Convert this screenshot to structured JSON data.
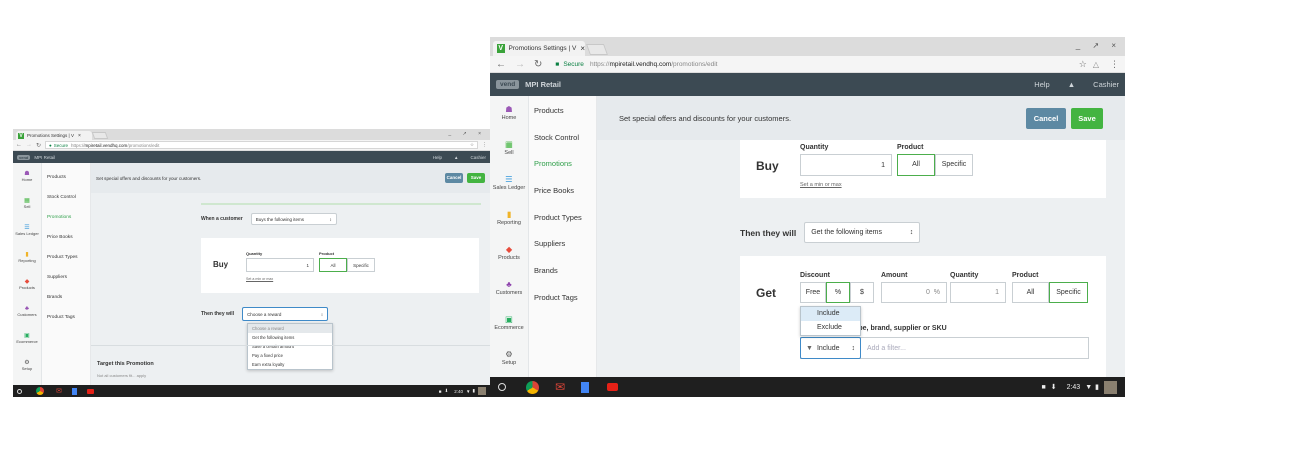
{
  "browser": {
    "tab_title": "Promotions Settings | V",
    "tab_close": "×",
    "window_controls": "_ ↗ ×",
    "secure_label": "Secure",
    "url_scheme": "https://",
    "url_host": "mpiretail.vendhq.com",
    "url_path": "/promotions/edit"
  },
  "app": {
    "logo_text": "vend",
    "store_name": "MPI Retail",
    "help": "Help",
    "user": "Cashier"
  },
  "icon_nav": [
    {
      "label": "Home",
      "icon": "🏠",
      "color": "#9b59b6"
    },
    {
      "label": "Sell",
      "icon": "🛒",
      "color": "#43b441"
    },
    {
      "label": "Sales Ledger",
      "icon": "☰",
      "color": "#3498db"
    },
    {
      "label": "Reporting",
      "icon": "▮",
      "color": "#f0b429"
    },
    {
      "label": "Products",
      "icon": "◆",
      "color": "#e74c3c"
    },
    {
      "label": "Customers",
      "icon": "♣",
      "color": "#8e44ad"
    },
    {
      "label": "Ecommerce",
      "icon": "▣",
      "color": "#27ae60"
    },
    {
      "label": "Setup",
      "icon": "⚙",
      "color": "#555555"
    }
  ],
  "sub_nav": [
    "Products",
    "Stock Control",
    "Promotions",
    "Price Books",
    "Product Types",
    "Suppliers",
    "Brands",
    "Product Tags"
  ],
  "header": {
    "description": "Set special offers and discounts for your customers.",
    "cancel": "Cancel",
    "save": "Save"
  },
  "left_form": {
    "when_label": "When a customer",
    "when_value": "Buys the following items",
    "buy_label": "Buy",
    "quantity_label": "Quantity",
    "quantity_value": "1",
    "product_label": "Product",
    "all": "All",
    "specific": "Specific",
    "min_max_link": "Set a min or max",
    "then_label": "Then they will",
    "then_value": "Choose a reward",
    "reward_options": [
      "Choose a reward",
      "Get the following items",
      "Save a certain amount",
      "Pay a fixed price",
      "Earn extra loyalty"
    ],
    "target_title": "Target this Promotion",
    "target_desc": "Not all customers fit... apply"
  },
  "right_form": {
    "buy_label": "Buy",
    "quantity_label": "Quantity",
    "quantity_value": "1",
    "product_label": "Product",
    "all": "All",
    "specific": "Specific",
    "min_max_link": "Set a min or max",
    "then_label": "Then they will",
    "then_value": "Get the following items",
    "get_label": "Get",
    "discount_label": "Discount",
    "free": "Free",
    "percent": "%",
    "dollar": "$",
    "amount_label": "Amount",
    "amount_value": "0",
    "amount_unit": "%",
    "quantity2_label": "Quantity",
    "quantity2_value": "1",
    "product2_label": "Product",
    "all2": "All",
    "specific2": "Specific",
    "filter_hint": "g, type, brand, supplier or SKU",
    "include_value": "Include",
    "add_filter_placeholder": "Add a filter...",
    "include_options": [
      "Include",
      "Exclude"
    ]
  },
  "shelf": {
    "left_time": "2:40",
    "right_time": "2:43"
  },
  "colors": {
    "appbar": "#3c4a53",
    "save": "#43b441",
    "cancel": "#5d89a3",
    "active_nav": "#2f9f4a"
  }
}
